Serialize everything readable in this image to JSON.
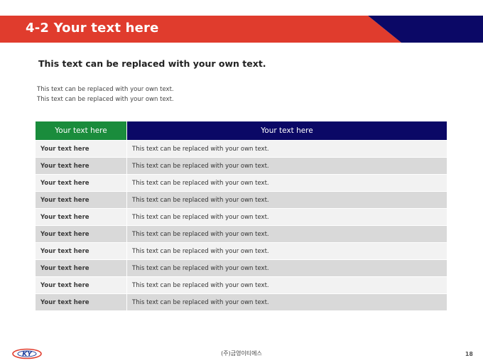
{
  "slide": {
    "title": "4-2 Your text here",
    "subtitle": "This text can be replaced with your own text.",
    "body_lines": [
      "This text can be replaced with your own text.",
      "This text can be replaced with your own text."
    ],
    "colors": {
      "header_red": "#e03c2d",
      "header_navy": "#0b0866",
      "table_green": "#1a8c3c"
    }
  },
  "table": {
    "headers": [
      "Your text here",
      "Your text here"
    ],
    "rows": [
      [
        "Your text here",
        "This text can be replaced with your own text."
      ],
      [
        "Your text here",
        "This text can be replaced with your own text."
      ],
      [
        "Your text here",
        "This text can be replaced with your own text."
      ],
      [
        "Your text here",
        "This text can be replaced with your own text."
      ],
      [
        "Your text here",
        "This text can be replaced with your own text."
      ],
      [
        "Your text here",
        "This text can be replaced with your own text."
      ],
      [
        "Your text here",
        "This text can be replaced with your own text."
      ],
      [
        "Your text here",
        "This text can be replaced with your own text."
      ],
      [
        "Your text here",
        "This text can be replaced with your own text."
      ],
      [
        "Your text here",
        "This text can be replaced with your own text."
      ]
    ]
  },
  "footer": {
    "logo_text": "KY",
    "company": "(주)금영이티에스",
    "page_number": "18"
  }
}
